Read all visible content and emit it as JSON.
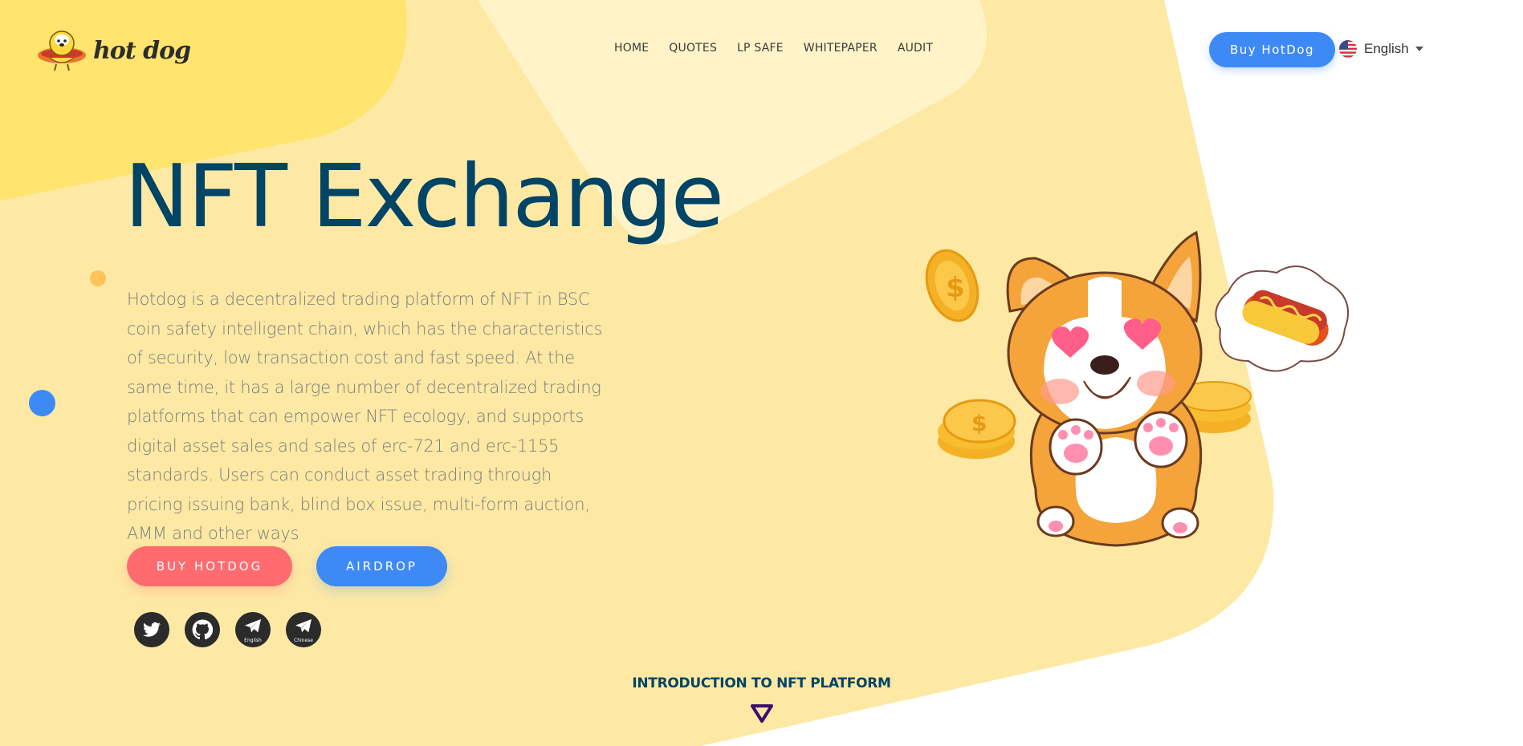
{
  "brand": {
    "name": "hot dog"
  },
  "nav": {
    "items": [
      {
        "label": "HOME"
      },
      {
        "label": "QUOTES"
      },
      {
        "label": "LP SAFE"
      },
      {
        "label": "WHITEPAPER"
      },
      {
        "label": "AUDIT"
      }
    ]
  },
  "header": {
    "buy_label": "Buy HotDog",
    "language": "English"
  },
  "hero": {
    "title": "NFT Exchange",
    "description": "Hotdog is a decentralized trading platform of NFT in BSC coin safety intelligent chain, which has the characteristics of security, low transaction cost and fast speed. At the same time, it has a large number of decentralized trading platforms that can empower NFT ecology, and supports digital asset sales and sales of erc-721 and erc-1155 standards. Users can conduct asset trading through pricing issuing bank, blind box issue, multi-form auction, AMM and other ways",
    "buy_button": "BUY HOTDOG",
    "airdrop_button": "AIRDROP"
  },
  "socials": [
    {
      "icon": "twitter-icon",
      "caption": ""
    },
    {
      "icon": "github-icon",
      "caption": ""
    },
    {
      "icon": "telegram-icon",
      "caption": "English"
    },
    {
      "icon": "telegram-icon",
      "caption": "Chinese"
    }
  ],
  "intro": {
    "label": "INTRODUCTION TO NFT PLATFORM"
  },
  "colors": {
    "background_yellow": "#fde9a4",
    "title_blue": "#004466",
    "accent_blue": "#3d8af7",
    "accent_red": "#ff6b6f",
    "text_gray": "#7c7c7c"
  }
}
